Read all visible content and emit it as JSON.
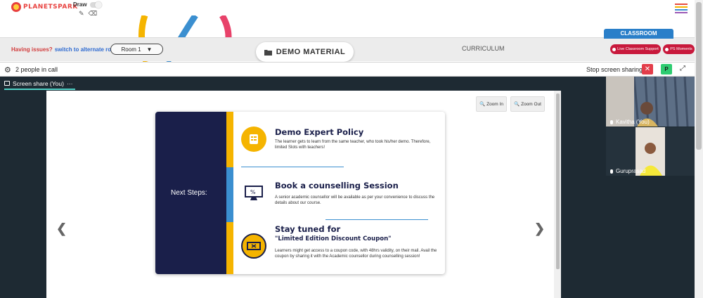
{
  "header": {
    "logo_text": "PLANETSPARK",
    "draw_label": "Draw",
    "draw_enabled": false,
    "menu_colors": [
      "#e84c3d",
      "#f5b400",
      "#3b8fd0",
      "#9b59b6"
    ]
  },
  "nav": {
    "issue_text": "Having issues?",
    "issue_link": "switch to alternate room",
    "room_value": "Room 1",
    "demo_material": "DEMO MATERIAL",
    "curriculum": "CURRICULUM",
    "classroom": "CLASSROOM",
    "live_support": "Live Classroom Support",
    "ps_moments": "PS Moments"
  },
  "call": {
    "people_count": "2 people in call",
    "stop_sharing": "Stop screen sharing",
    "p_badge": "P"
  },
  "share": {
    "tab_label": "Screen share (You)",
    "tab_more": "···",
    "zoom_in": "Zoom In",
    "zoom_out": "Zoom Out"
  },
  "slide": {
    "next_steps": "Next Steps:",
    "items": [
      {
        "title": "Demo Expert Policy",
        "desc": "The learner gets to learn from the same teacher, who took his/her demo. Therefore, limited Slots with teachers!"
      },
      {
        "title": "Book a counselling Session",
        "desc": "A senior academic counsellor will be available as per your convenience to discuss the details about our course."
      },
      {
        "title": "Stay tuned for",
        "subtitle": "\"Limited Edition Discount Coupon\"",
        "desc": "Learners might get access to a coupon code, with 48hrs validity, on their mail. Avail the coupon by sharing it with the Academic counsellor during counselling session!"
      }
    ]
  },
  "participants": [
    {
      "name": "Kavitha (You)"
    },
    {
      "name": "Guruprasad"
    }
  ],
  "colors": {
    "navy": "#1a1f4a",
    "yellow": "#f5b400",
    "blue": "#3b8fd0",
    "red_button": "#c8193c",
    "classroom_blue": "#2a7fc9",
    "share_bg": "#1e2a33"
  }
}
